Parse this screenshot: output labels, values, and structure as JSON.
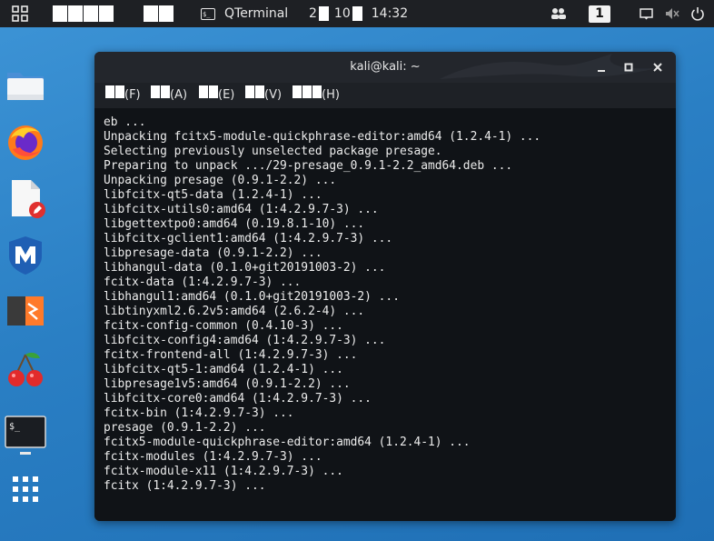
{
  "topbar": {
    "app_name": "QTerminal",
    "date_day": "2",
    "date_num": "10",
    "time": "14:32",
    "workspace_number": "1"
  },
  "dock": {
    "items": [
      {
        "icon": "file-manager-icon"
      },
      {
        "icon": "firefox-icon"
      },
      {
        "icon": "text-editor-icon"
      },
      {
        "icon": "metasploit-icon"
      },
      {
        "icon": "burpsuite-icon"
      },
      {
        "icon": "cherrytree-icon"
      },
      {
        "icon": "terminal-icon"
      },
      {
        "icon": "app-grid-icon"
      }
    ]
  },
  "window": {
    "title": "kali@kali: ~",
    "menu": [
      "(F)",
      "(A)",
      "(E)",
      "(V)",
      "(H)"
    ],
    "terminal_lines": [
      "eb ...",
      "Unpacking fcitx5-module-quickphrase-editor:amd64 (1.2.4-1) ...",
      "Selecting previously unselected package presage.",
      "Preparing to unpack .../29-presage_0.9.1-2.2_amd64.deb ...",
      "Unpacking presage (0.9.1-2.2) ...",
      "libfcitx-qt5-data (1.2.4-1) ...",
      "libfcitx-utils0:amd64 (1:4.2.9.7-3) ...",
      "libgettextpo0:amd64 (0.19.8.1-10) ...",
      "libfcitx-gclient1:amd64 (1:4.2.9.7-3) ...",
      "libpresage-data (0.9.1-2.2) ...",
      "libhangul-data (0.1.0+git20191003-2) ...",
      "fcitx-data (1:4.2.9.7-3) ...",
      "libhangul1:amd64 (0.1.0+git20191003-2) ...",
      "libtinyxml2.6.2v5:amd64 (2.6.2-4) ...",
      "fcitx-config-common (0.4.10-3) ...",
      "libfcitx-config4:amd64 (1:4.2.9.7-3) ...",
      "fcitx-frontend-all (1:4.2.9.7-3) ...",
      "libfcitx-qt5-1:amd64 (1.2.4-1) ...",
      "libpresage1v5:amd64 (0.9.1-2.2) ...",
      "libfcitx-core0:amd64 (1:4.2.9.7-3) ...",
      "fcitx-bin (1:4.2.9.7-3) ...",
      "presage (0.9.1-2.2) ...",
      "fcitx5-module-quickphrase-editor:amd64 (1.2.4-1) ...",
      "fcitx-modules (1:4.2.9.7-3) ...",
      "fcitx-module-x11 (1:4.2.9.7-3) ...",
      "fcitx (1:4.2.9.7-3) ..."
    ]
  },
  "colors": {
    "desktop": "#2a7fc4",
    "panel": "#1e2024",
    "terminal_bg": "#101317",
    "terminal_fg": "#ececec"
  }
}
